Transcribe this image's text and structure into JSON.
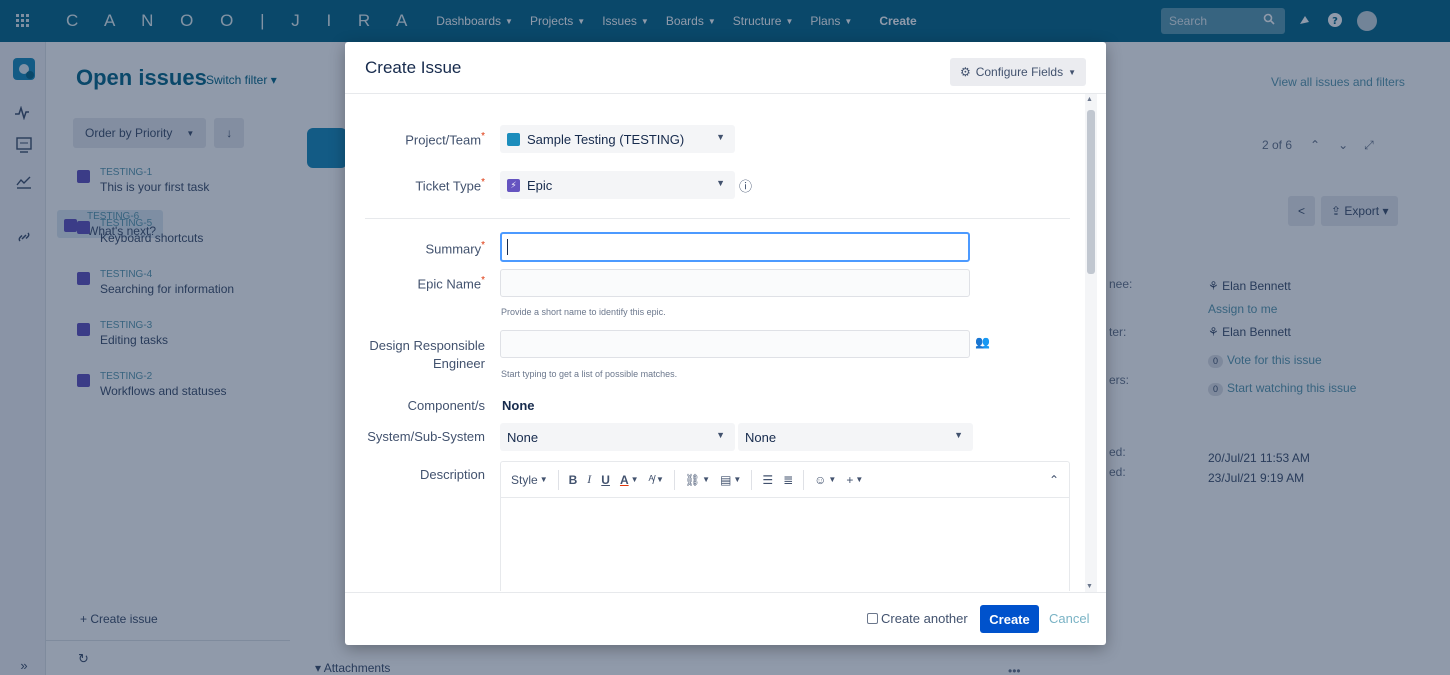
{
  "nav": {
    "logo": "C A N O O | J I R A",
    "items": [
      {
        "label": "Dashboards"
      },
      {
        "label": "Projects"
      },
      {
        "label": "Issues"
      },
      {
        "label": "Boards"
      },
      {
        "label": "Structure"
      },
      {
        "label": "Plans"
      }
    ],
    "create_label": "Create",
    "search_placeholder": "Search"
  },
  "issues_panel": {
    "title": "Open issues",
    "switch_filter": "Switch filter",
    "order_by": "Order by Priority",
    "issues": [
      {
        "key": "TESTING-1",
        "summary": "This is your first task"
      },
      {
        "key": "TESTING-6",
        "summary": "What's next?"
      },
      {
        "key": "TESTING-5",
        "summary": "Keyboard shortcuts"
      },
      {
        "key": "TESTING-4",
        "summary": "Searching for information"
      },
      {
        "key": "TESTING-3",
        "summary": "Editing tasks"
      },
      {
        "key": "TESTING-2",
        "summary": "Workflows and statuses"
      }
    ],
    "create_issue": "+ Create issue"
  },
  "detail": {
    "view_all": "View all issues and filters",
    "pager": "2 of 6",
    "export": "Export",
    "assignee": "Elan Bennett",
    "assign_to_me": "Assign to me",
    "reporter": "Elan Bennett",
    "votes_count": "0",
    "vote_label": "Vote for this issue",
    "watchers_count": "0",
    "watch_label": "Start watching this issue",
    "created": "20/Jul/21 11:53 AM",
    "updated": "23/Jul/21 9:19 AM",
    "attachments": "Attachments",
    "label_fragments": [
      "nee:",
      "ter:",
      "ers:",
      "ed:",
      "ed:"
    ]
  },
  "modal": {
    "title": "Create Issue",
    "configure_fields": "Configure Fields",
    "fields": {
      "project_label": "Project/Team",
      "project_value": "Sample Testing (TESTING)",
      "type_label": "Ticket Type",
      "type_value": "Epic",
      "summary_label": "Summary",
      "summary_value": "",
      "epic_label": "Epic Name",
      "epic_hint": "Provide a short name to identify this epic.",
      "design_label_1": "Design Responsible",
      "design_label_2": "Engineer",
      "design_hint": "Start typing to get a list of possible matches.",
      "component_label": "Component/s",
      "component_value": "None",
      "system_label": "System/Sub-System",
      "system_value_1": "None",
      "system_value_2": "None",
      "description_label": "Description"
    },
    "editor_toolbar": {
      "style": "Style",
      "bold": "B",
      "italic": "I",
      "underline": "U",
      "text_color": "A"
    },
    "create_another": "Create another",
    "create_button": "Create",
    "cancel": "Cancel"
  },
  "colors": {
    "nav_bg": "#0c6b8a",
    "accent": "#0052cc",
    "link": "#5e9cb1",
    "epic": "#6554c0"
  }
}
